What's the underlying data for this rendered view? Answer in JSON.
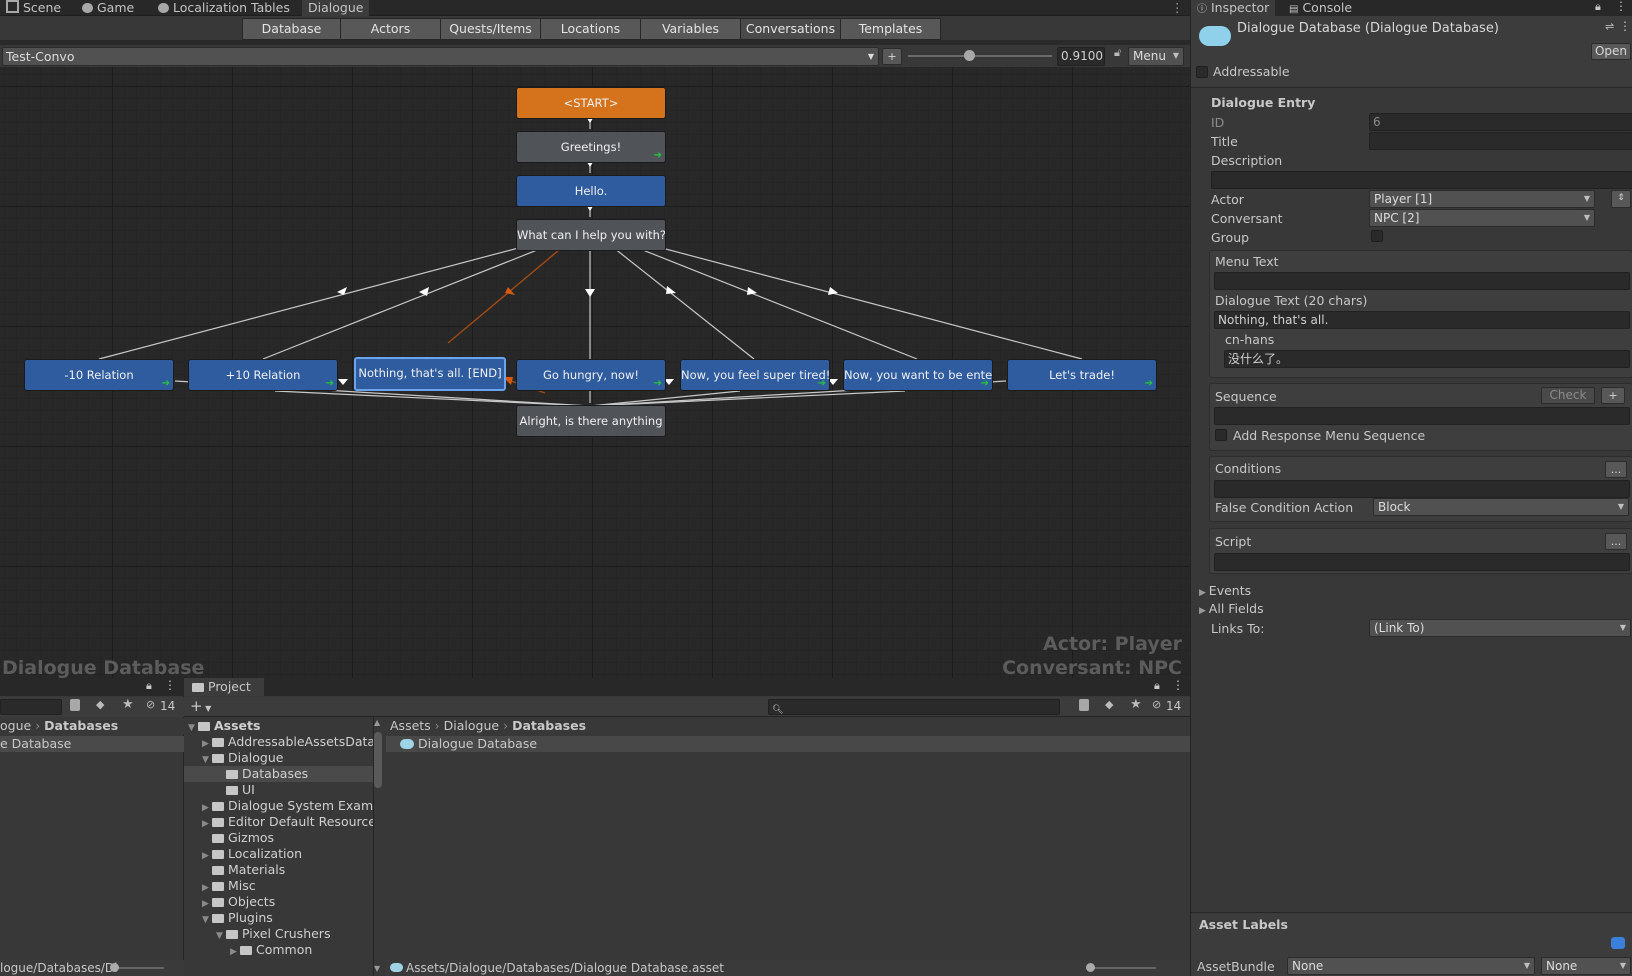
{
  "window_tabs": [
    "Scene",
    "Game",
    "Localization Tables",
    "Dialogue"
  ],
  "editor": {
    "tabs": [
      "Database",
      "Actors",
      "Quests/Items",
      "Locations",
      "Variables",
      "Conversations",
      "Templates"
    ],
    "active_tab": "Conversations",
    "conversation": "Test-Convo",
    "add_label": "+",
    "zoom": "0.9100",
    "menu_label": "Menu",
    "overlay_left": "Dialogue Database",
    "overlay_actor": "Actor: Player",
    "overlay_conversant": "Conversant: NPC",
    "nodes": {
      "start": "<START>",
      "greetings": "Greetings!",
      "hello": "Hello.",
      "help": "What can I help you with?",
      "minus10": "-10 Relation",
      "plus10": "+10 Relation",
      "nothing": "Nothing, that's all. [END]",
      "hungry": "Go hungry, now!",
      "tired": "Now, you feel super tired!",
      "entertain": "Now, you want to be entert",
      "trade": "Let's trade!",
      "alright": "Alright, is there anything"
    }
  },
  "left_panel": {
    "breadcrumb": [
      "ogue",
      "Databases"
    ],
    "item": "e Database",
    "count": "14",
    "path": "logue/Databases/Di"
  },
  "project": {
    "tab": "Project",
    "add_label": "+",
    "count": "14",
    "search_placeholder": "",
    "tree": [
      {
        "label": "Assets",
        "depth": 0,
        "expanded": true,
        "bold": true
      },
      {
        "label": "AddressableAssetsData",
        "depth": 1,
        "expanded": false
      },
      {
        "label": "Dialogue",
        "depth": 1,
        "expanded": true
      },
      {
        "label": "Databases",
        "depth": 2,
        "selected": true
      },
      {
        "label": "UI",
        "depth": 2
      },
      {
        "label": "Dialogue System Exampl",
        "depth": 1,
        "expanded": false
      },
      {
        "label": "Editor Default Resources",
        "depth": 1,
        "expanded": false
      },
      {
        "label": "Gizmos",
        "depth": 1
      },
      {
        "label": "Localization",
        "depth": 1,
        "expanded": false
      },
      {
        "label": "Materials",
        "depth": 1
      },
      {
        "label": "Misc",
        "depth": 1,
        "expanded": false
      },
      {
        "label": "Objects",
        "depth": 1,
        "expanded": false
      },
      {
        "label": "Plugins",
        "depth": 1,
        "expanded": true
      },
      {
        "label": "Pixel Crushers",
        "depth": 2,
        "expanded": true
      },
      {
        "label": "Common",
        "depth": 3,
        "expanded": false
      }
    ],
    "breadcrumb": [
      "Assets",
      "Dialogue",
      "Databases"
    ],
    "files": [
      "Dialogue Database"
    ],
    "status_path": "Assets/Dialogue/Databases/Dialogue Database.asset"
  },
  "inspector": {
    "tabs": [
      "Inspector",
      "Console"
    ],
    "asset_title": "Dialogue Database (Dialogue Database)",
    "open_label": "Open",
    "addressable_label": "Addressable",
    "section_title": "Dialogue Entry",
    "id_label": "ID",
    "id_value": "6",
    "title_label": "Title",
    "title_value": "",
    "description_label": "Description",
    "description_value": "",
    "actor_label": "Actor",
    "actor_value": "Player [1]",
    "conversant_label": "Conversant",
    "conversant_value": "NPC [2]",
    "group_label": "Group",
    "menu_text_label": "Menu Text",
    "menu_text_value": "",
    "dialogue_text_label": "Dialogue Text (20 chars)",
    "dialogue_text_value": "Nothing, that's all.",
    "locale_label": "cn-hans",
    "locale_value": "没什么了。",
    "sequence_label": "Sequence",
    "check_label": "Check",
    "plus_label": "+",
    "add_response_label": "Add Response Menu Sequence",
    "conditions_label": "Conditions",
    "ellipsis": "...",
    "false_condition_label": "False Condition Action",
    "false_condition_value": "Block",
    "script_label": "Script",
    "events_label": "Events",
    "all_fields_label": "All Fields",
    "links_to_label": "Links To:",
    "links_to_value": "(Link To)",
    "asset_labels_title": "Asset Labels",
    "assetbundle_label": "AssetBundle",
    "assetbundle_value": "None",
    "assetbundle_variant": "None"
  },
  "colors": {
    "start_node": "#d4731b",
    "npc_node": "#505459",
    "player_node": "#2e5c9f",
    "link_line": "#c8c8c8",
    "selected_link": "#b04a10"
  }
}
